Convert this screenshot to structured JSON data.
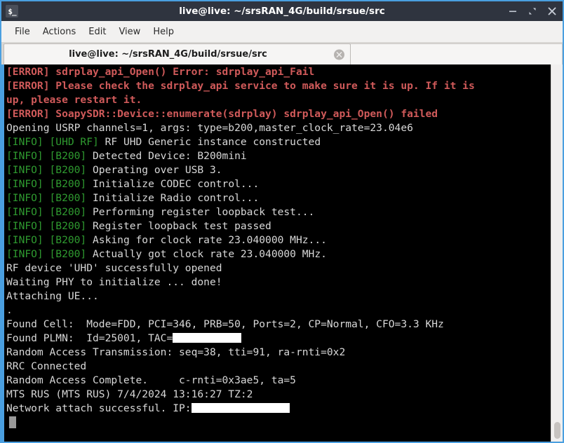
{
  "window": {
    "title": "live@live: ~/srsRAN_4G/build/srsue/src",
    "app_icon": "terminal-prompt-icon",
    "controls": {
      "minimize": "minimize-icon",
      "maximize": "maximize-icon",
      "close": "close-icon"
    }
  },
  "menubar": {
    "items": [
      {
        "label": "File"
      },
      {
        "label": "Actions"
      },
      {
        "label": "Edit"
      },
      {
        "label": "View"
      },
      {
        "label": "Help"
      }
    ]
  },
  "tabbar": {
    "tabs": [
      {
        "title": "live@live: ~/srsRAN_4G/build/srsue/src",
        "close_icon": "close-icon"
      }
    ]
  },
  "terminal": {
    "lines": [
      {
        "id": 0,
        "segments": [
          {
            "text": "[ERROR] sdrplay_api_Open() Error: sdrplay_api_Fail",
            "color": "red"
          }
        ]
      },
      {
        "id": 1,
        "segments": [
          {
            "text": "[ERROR] Please check the sdrplay_api service to make sure it is up. If it is",
            "color": "red"
          }
        ]
      },
      {
        "id": 2,
        "segments": [
          {
            "text": "up, please restart it.",
            "color": "red"
          }
        ]
      },
      {
        "id": 3,
        "segments": [
          {
            "text": "[ERROR] SoapySDR::Device::enumerate(sdrplay) sdrplay_api_Open() failed",
            "color": "red"
          }
        ]
      },
      {
        "id": 4,
        "segments": [
          {
            "text": "Opening USRP channels=1, args: type=b200,master_clock_rate=23.04e6",
            "color": "white"
          }
        ]
      },
      {
        "id": 5,
        "segments": [
          {
            "text": "[INFO] [UHD RF]",
            "color": "green"
          },
          {
            "text": " RF UHD Generic instance constructed",
            "color": "white"
          }
        ]
      },
      {
        "id": 6,
        "segments": [
          {
            "text": "[INFO] [B200]",
            "color": "green"
          },
          {
            "text": " Detected Device: B200mini",
            "color": "white"
          }
        ]
      },
      {
        "id": 7,
        "segments": [
          {
            "text": "[INFO] [B200]",
            "color": "green"
          },
          {
            "text": " Operating over USB 3.",
            "color": "white"
          }
        ]
      },
      {
        "id": 8,
        "segments": [
          {
            "text": "[INFO] [B200]",
            "color": "green"
          },
          {
            "text": " Initialize CODEC control...",
            "color": "white"
          }
        ]
      },
      {
        "id": 9,
        "segments": [
          {
            "text": "[INFO] [B200]",
            "color": "green"
          },
          {
            "text": " Initialize Radio control...",
            "color": "white"
          }
        ]
      },
      {
        "id": 10,
        "segments": [
          {
            "text": "[INFO] [B200]",
            "color": "green"
          },
          {
            "text": " Performing register loopback test...",
            "color": "white"
          }
        ]
      },
      {
        "id": 11,
        "segments": [
          {
            "text": "[INFO] [B200]",
            "color": "green"
          },
          {
            "text": " Register loopback test passed",
            "color": "white"
          }
        ]
      },
      {
        "id": 12,
        "segments": [
          {
            "text": "[INFO] [B200]",
            "color": "green"
          },
          {
            "text": " Asking for clock rate 23.040000 MHz...",
            "color": "white"
          }
        ]
      },
      {
        "id": 13,
        "segments": [
          {
            "text": "[INFO] [B200]",
            "color": "green"
          },
          {
            "text": " Actually got clock rate 23.040000 MHz.",
            "color": "white"
          }
        ]
      },
      {
        "id": 14,
        "segments": [
          {
            "text": "RF device 'UHD' successfully opened",
            "color": "white"
          }
        ]
      },
      {
        "id": 15,
        "segments": [
          {
            "text": "Waiting PHY to initialize ... done!",
            "color": "white"
          }
        ]
      },
      {
        "id": 16,
        "segments": [
          {
            "text": "Attaching UE...",
            "color": "white"
          }
        ]
      },
      {
        "id": 17,
        "segments": [
          {
            "text": ".",
            "color": "white"
          }
        ]
      },
      {
        "id": 18,
        "segments": [
          {
            "text": "Found Cell:  Mode=FDD, PCI=346, PRB=50, Ports=2, CP=Normal, CFO=3.3 KHz",
            "color": "white"
          }
        ]
      },
      {
        "id": 19,
        "segments": [
          {
            "text": "Found PLMN:  Id=25001, TAC=",
            "color": "white"
          },
          {
            "redact": "tac"
          }
        ]
      },
      {
        "id": 20,
        "segments": [
          {
            "text": "Random Access Transmission: seq=38, tti=91, ra-rnti=0x2",
            "color": "white"
          }
        ]
      },
      {
        "id": 21,
        "segments": [
          {
            "text": "RRC Connected",
            "color": "white"
          }
        ]
      },
      {
        "id": 22,
        "segments": [
          {
            "text": "Random Access Complete.     c-rnti=0x3ae5, ta=5",
            "color": "white"
          }
        ]
      },
      {
        "id": 23,
        "segments": [
          {
            "text": "MTS RUS (MTS RUS) 7/4/2024 13:16:27 TZ:2",
            "color": "white"
          }
        ]
      },
      {
        "id": 24,
        "segments": [
          {
            "text": "Network attach successful. IP:",
            "color": "white"
          },
          {
            "redact": "ip"
          }
        ]
      }
    ],
    "cursor_line_index": 25,
    "scrollbar": "vertical-scrollbar"
  },
  "colors": {
    "window_border": "#4a9fe0",
    "titlebar_bg": "#2f343f",
    "terminal_bg": "#000000",
    "error_red": "#d05a5a",
    "info_green": "#2f9b30",
    "text_white": "#d6d6d6"
  }
}
